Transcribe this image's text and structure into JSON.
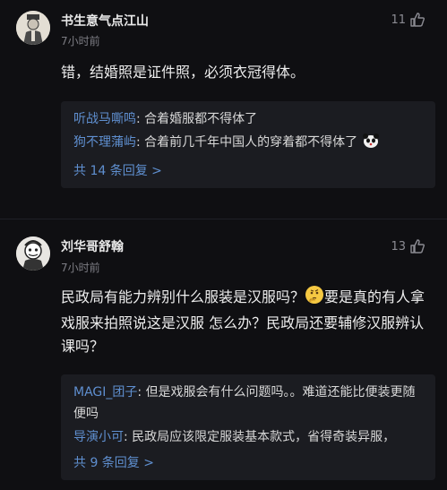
{
  "comments": [
    {
      "username": "书生意气点江山",
      "time": "7小时前",
      "likes": "11",
      "text": "错，结婚照是证件照，必须衣冠得体。",
      "replies": [
        {
          "name": "听战马嘶鸣",
          "sep": ": ",
          "text": "合着婚服都不得体了"
        },
        {
          "name": "狗不理蒲屿",
          "sep": ": ",
          "text": "合着前几千年中国人的穿着都不得体了",
          "emoji": "panda-emoji"
        }
      ],
      "more": "共 14 条回复 >"
    },
    {
      "username": "刘华哥舒翰",
      "time": "7小时前",
      "likes": "13",
      "text_before_emoji": "民政局有能力辨别什么服装是汉服吗？",
      "text_after_emoji": "要是真的有人拿戏服来拍照说这是汉服 怎么办？民政局还要辅修汉服辨认课吗？",
      "replies": [
        {
          "name": "MAGI_团子",
          "sep": ": ",
          "text": "但是戏服会有什么问题吗。。难道还能比便装更随便吗"
        },
        {
          "name": "导演小可",
          "sep": ": ",
          "text": "民政局应该限定服装基本款式，省得奇装异服，"
        }
      ],
      "more": "共 9 条回复 >"
    }
  ],
  "colors": {
    "background": "#0f0f12",
    "reply_box": "#1b1c21",
    "link_blue": "#5f8fd0",
    "muted": "#7d7d84"
  },
  "icons": [
    "thumbs-up-icon",
    "thinking-emoji",
    "panda-emoji"
  ]
}
